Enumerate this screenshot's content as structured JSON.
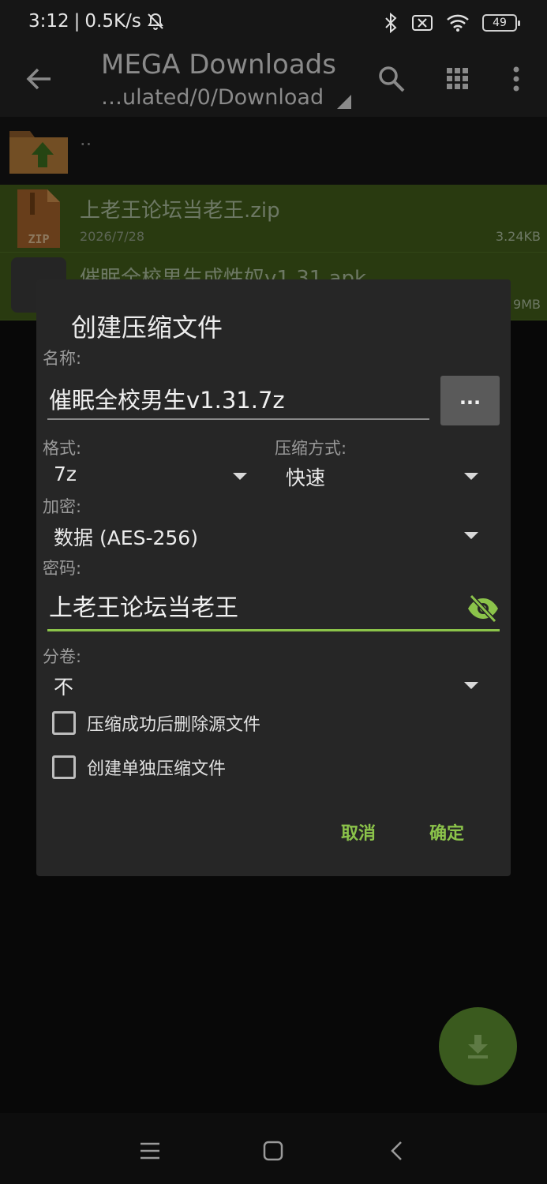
{
  "status_bar": {
    "time": "3:12",
    "speed": "0.5K/s",
    "battery": "49"
  },
  "app_bar": {
    "title": "MEGA Downloads",
    "path": "…ulated/0/Download"
  },
  "files": [
    {
      "name": "..",
      "type": "parent-folder"
    },
    {
      "name": "上老王论坛当老王.zip",
      "date": "2026/7/28",
      "size": "3.24KB",
      "icon_label": "ZIP",
      "selected": true
    },
    {
      "name": "催眠全校男生成性奴v1.31.apk",
      "size_partial": "9MB",
      "selected": true
    }
  ],
  "dialog": {
    "title": "创建压缩文件",
    "name_label": "名称:",
    "name_value": "催眠全校男生v1.31.7z",
    "browse_label": "...",
    "format_label": "格式:",
    "format_value": "7z",
    "method_label": "压缩方式:",
    "method_value": "快速",
    "encrypt_label": "加密:",
    "encrypt_value": "数据 (AES-256)",
    "password_label": "密码:",
    "password_value": "上老王论坛当老王",
    "split_label": "分卷:",
    "split_value": "不",
    "checkbox_delete": "压缩成功后删除源文件",
    "checkbox_separate": "创建单独压缩文件",
    "cancel": "取消",
    "ok": "确定"
  },
  "colors": {
    "accent": "#8bc34a",
    "selection": "#3f5a1a",
    "dialog_bg": "#262626"
  }
}
